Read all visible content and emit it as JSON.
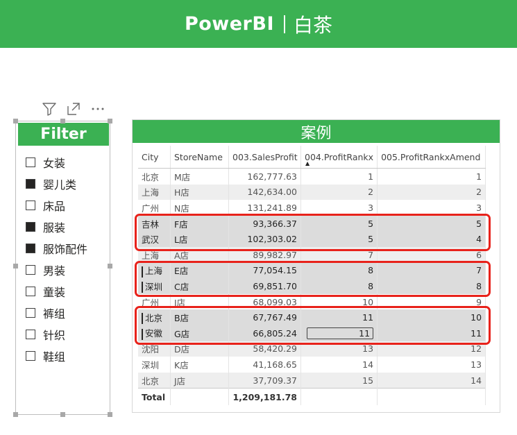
{
  "header": {
    "brand": "PowerBI",
    "subtitle": "白茶"
  },
  "colors": {
    "accent": "#3bb153",
    "highlight": "#e8221b"
  },
  "toolbar": {
    "icons": [
      "filter-icon",
      "focus-mode-icon",
      "more-options-icon"
    ]
  },
  "slicer": {
    "title": "Filter",
    "items": [
      {
        "label": "女装",
        "checked": false
      },
      {
        "label": "婴儿类",
        "checked": true
      },
      {
        "label": "床品",
        "checked": false
      },
      {
        "label": "服装",
        "checked": true
      },
      {
        "label": "服饰配件",
        "checked": true
      },
      {
        "label": "男装",
        "checked": false
      },
      {
        "label": "童装",
        "checked": false
      },
      {
        "label": "裤组",
        "checked": false
      },
      {
        "label": "针织",
        "checked": false
      },
      {
        "label": "鞋组",
        "checked": false
      }
    ]
  },
  "table": {
    "title": "案例",
    "columns": [
      "City",
      "StoreName",
      "003.SalesProfit",
      "004.ProfitRankx",
      "005.ProfitRankxAmend"
    ],
    "rows": [
      [
        "北京",
        "M店",
        "162,777.63",
        "1",
        "1"
      ],
      [
        "上海",
        "H店",
        "142,634.00",
        "2",
        "2"
      ],
      [
        "广州",
        "N店",
        "131,241.89",
        "3",
        "3"
      ],
      [
        "吉林",
        "F店",
        "93,366.37",
        "5",
        "5"
      ],
      [
        "武汉",
        "L店",
        "102,303.02",
        "5",
        "4"
      ],
      [
        "上海",
        "A店",
        "89,982.97",
        "7",
        "6"
      ],
      [
        "上海",
        "E店",
        "77,054.15",
        "8",
        "7"
      ],
      [
        "深圳",
        "C店",
        "69,851.70",
        "8",
        "8"
      ],
      [
        "广州",
        "I店",
        "68,099.03",
        "10",
        "9"
      ],
      [
        "北京",
        "B店",
        "67,767.49",
        "11",
        "10"
      ],
      [
        "安徽",
        "G店",
        "66,805.24",
        "11",
        "11"
      ],
      [
        "沈阳",
        "D店",
        "58,420.29",
        "13",
        "12"
      ],
      [
        "深圳",
        "K店",
        "41,168.65",
        "14",
        "13"
      ],
      [
        "北京",
        "J店",
        "37,709.37",
        "15",
        "14"
      ]
    ],
    "total": {
      "label": "Total",
      "value": "1,209,181.78"
    }
  }
}
